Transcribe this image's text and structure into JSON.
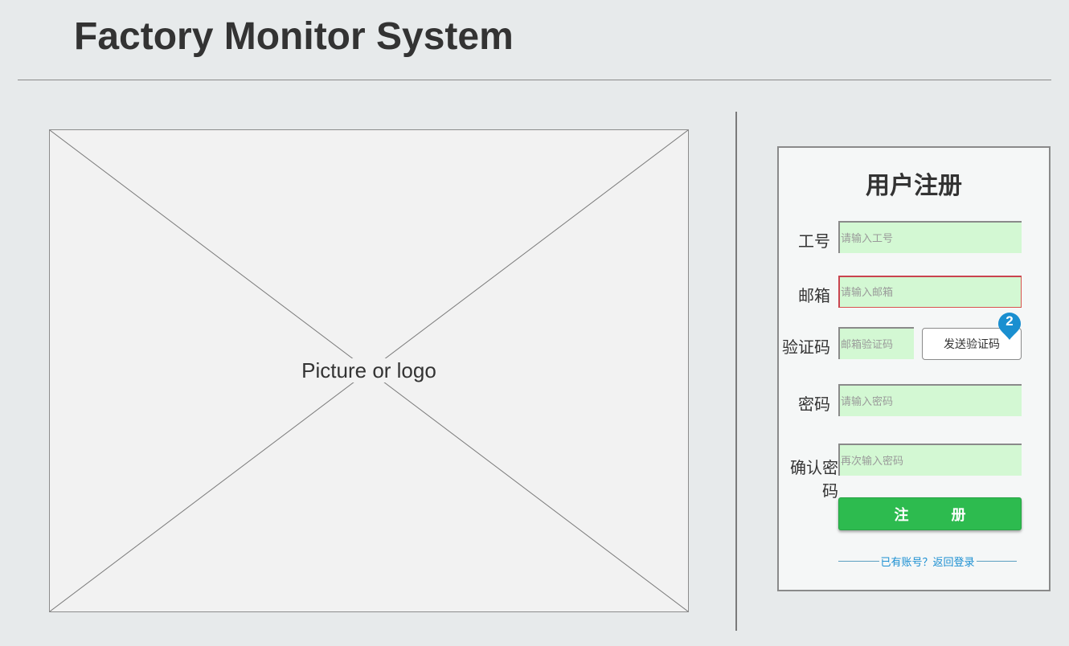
{
  "header": {
    "title": "Factory Monitor System"
  },
  "image_placeholder": {
    "label": "Picture or logo"
  },
  "register": {
    "title": "用户注册",
    "fields": {
      "employee_id": {
        "label": "工号",
        "placeholder": "请输入工号",
        "value": ""
      },
      "email": {
        "label": "邮箱",
        "placeholder": "请输入邮箱",
        "value": "",
        "state": "error"
      },
      "code": {
        "label": "验证码",
        "placeholder": "邮箱验证码",
        "value": ""
      },
      "password": {
        "label": "密码",
        "placeholder": "请输入密码",
        "value": ""
      },
      "confirm_password": {
        "label": "确认密码",
        "placeholder": "再次输入密码",
        "value": ""
      }
    },
    "send_code_label": "发送验证码",
    "badge": "2",
    "submit_label": "注 册",
    "login_link": "已有账号？返回登录"
  },
  "colors": {
    "background": "#e7eaeb",
    "input_fill": "#d3f8d3",
    "submit_green": "#2dbb4f",
    "link_blue": "#1b8fd2",
    "badge_blue": "#1a8fd0",
    "error_red": "#d9534f"
  },
  "icons": {
    "badge": "map-pin-badge-icon"
  }
}
